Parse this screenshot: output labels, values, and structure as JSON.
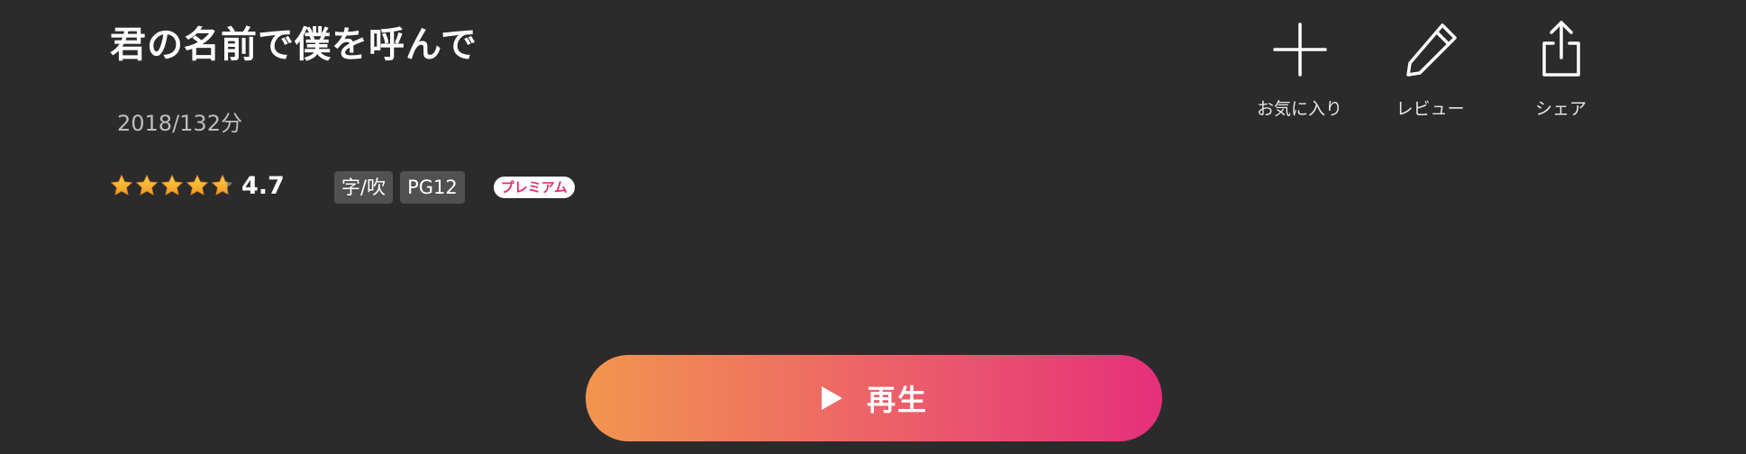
{
  "title": "君の名前で僕を呼んで",
  "meta": "2018/132分",
  "rating": {
    "value": 4.7,
    "value_text": "4.7",
    "max": 5,
    "star_color_top": "#ffcf4a",
    "star_color_bottom": "#f29a1e",
    "empty_star_color": "#7a7a7a"
  },
  "badges": [
    "字/吹",
    "PG12"
  ],
  "premium_label": "プレミアム",
  "actions": {
    "favorite": {
      "label": "お気に入り",
      "icon": "plus-icon"
    },
    "review": {
      "label": "レビュー",
      "icon": "pencil-icon"
    },
    "share": {
      "label": "シェア",
      "icon": "share-icon"
    }
  },
  "play_button": {
    "label": "再生",
    "icon": "play-icon",
    "gradient": [
      "#f2954f",
      "#ec5e6a",
      "#e5307a"
    ]
  },
  "colors": {
    "background": "#2b2b2b",
    "badge_background": "#515151",
    "premium_text": "#e0336d"
  }
}
